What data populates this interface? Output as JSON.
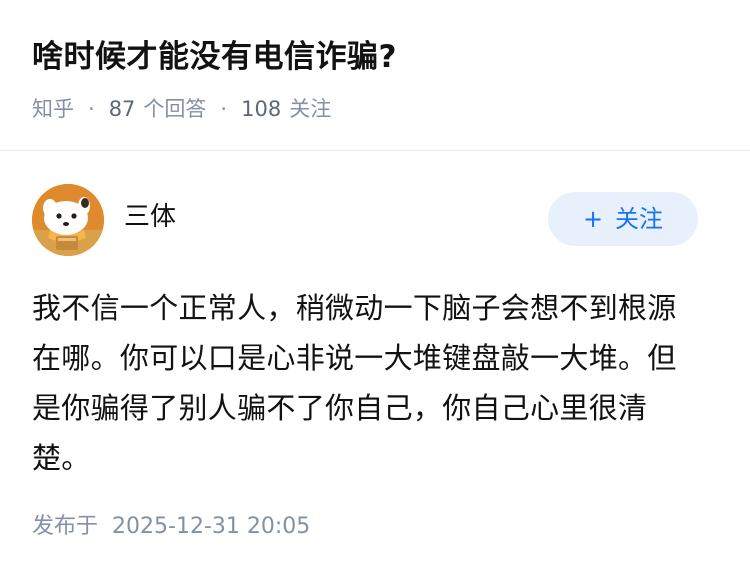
{
  "question": {
    "title": "啥时候才能没有电信诈骗?",
    "source": "知乎",
    "answer_count": "87",
    "answer_label": "个回答",
    "follower_count": "108",
    "follower_label": "关注",
    "separator": "·"
  },
  "author": {
    "name": "三体",
    "avatar_icon": "cartoon-dog-avatar",
    "follow_plus": "+",
    "follow_label": "关注"
  },
  "answer": {
    "content": "我不信一个正常人，稍微动一下脑子会想不到根源在哪。你可以口是心非说一大堆键盘敲一大堆。但是你骗得了别人骗不了你自己，你自己心里很清楚。",
    "publish_label": "发布于",
    "publish_time": "2025-12-31 20:05"
  },
  "colors": {
    "accent": "#1772f6",
    "follow_bg": "#e8f1fb",
    "meta_gray": "#8590a6",
    "avatar_orange": "#e58a2a"
  }
}
